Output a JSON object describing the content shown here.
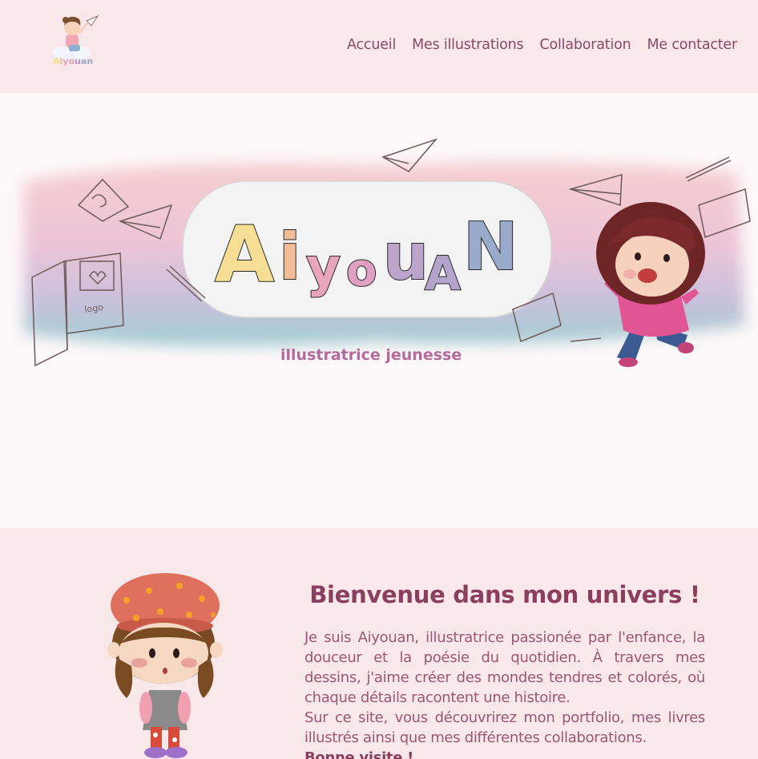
{
  "header": {
    "logo_text": "Aiyouan",
    "nav": [
      {
        "label": "Accueil"
      },
      {
        "label": "Mes illustrations"
      },
      {
        "label": "Collaboration"
      },
      {
        "label": "Me contacter"
      }
    ]
  },
  "banner": {
    "title": "Aiyouan",
    "subtitle": "illustratrice jeunesse",
    "book_label": "logo"
  },
  "welcome": {
    "title": "Bienvenue dans mon univers !",
    "paragraph1": "Je suis Aiyouan, illustratrice passionée par l'enfance, la douceur et la poésie du quotidien. À travers mes dessins, j'aime créer des mondes tendres et colorés, où chaque détails racontent une histoire.",
    "paragraph2": "Sur ce site, vous découvrirez mon portfolio, mes livres illustrés ainsi que mes différentes collaborations.",
    "closing": "Bonne visite !"
  },
  "colors": {
    "header_bg": "#f9e8e9",
    "text": "#8a4a66",
    "title": "#8a3f5e"
  }
}
